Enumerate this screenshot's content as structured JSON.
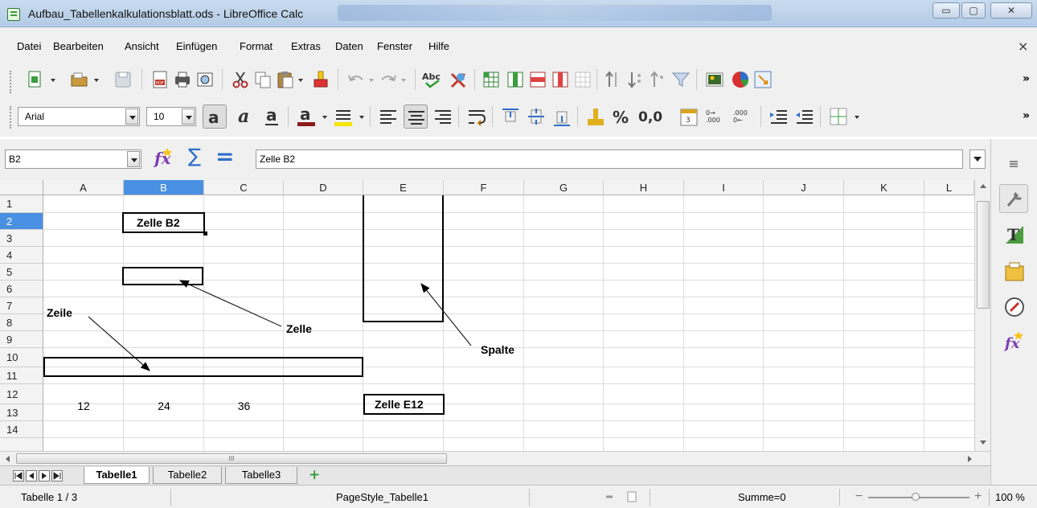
{
  "window": {
    "title": "Aufbau_Tabellenkalkulationsblatt.ods - LibreOffice Calc",
    "buttons": {
      "minimize": "▭",
      "maximize": "▢",
      "close": "✕"
    }
  },
  "menu": [
    "Datei",
    "Bearbeiten",
    "Ansicht",
    "Einfügen",
    "Format",
    "Extras",
    "Daten",
    "Fenster",
    "Hilfe"
  ],
  "menu_close": "×",
  "toolbar_standard": {
    "icons": [
      "new-document-icon",
      "open-icon",
      "save-icon",
      "export-pdf-icon",
      "print-icon",
      "print-preview-icon",
      "cut-icon",
      "copy-icon",
      "paste-icon",
      "clone-formatting-icon",
      "undo-icon",
      "redo-icon",
      "spellcheck-icon",
      "autospellcheck-icon",
      "row-insert-icon",
      "column-insert-icon",
      "row-delete-icon",
      "column-delete-icon",
      "merge-cells-icon",
      "sort-ascending-icon",
      "sort-descending-icon",
      "autofilter-icon",
      "filter-icon",
      "image-icon",
      "chart-icon",
      "pivot-table-icon"
    ],
    "spellcheck_label": "Abc",
    "more": "»"
  },
  "toolbar_formatting": {
    "font_name": "Arial",
    "font_size": "10",
    "percent": "%",
    "number_format": "0,0",
    "decimal_add": "0→ .000",
    "decimal_remove": ".000 0←",
    "more": "»"
  },
  "formula_bar": {
    "name_box": "B2",
    "content": "Zelle B2",
    "sum_symbol": "∑",
    "equals_symbol": "="
  },
  "sheet": {
    "columns": [
      "A",
      "B",
      "C",
      "D",
      "E",
      "F",
      "G",
      "H",
      "I",
      "J",
      "K",
      "L"
    ],
    "selected_column": "B",
    "rows": [
      "1",
      "2",
      "3",
      "4",
      "5",
      "6",
      "7",
      "8",
      "9",
      "10",
      "11",
      "12",
      "13",
      "14"
    ],
    "selected_row": "2",
    "cells": {
      "B2": "Zelle B2",
      "A12": "12",
      "B12": "24",
      "C12": "36",
      "E12": "Zelle E12"
    },
    "annotations": {
      "zeile": "Zeile",
      "zelle": "Zelle",
      "spalte": "Spalte"
    }
  },
  "hscroll_mark": "III",
  "tabs": [
    "Tabelle1",
    "Tabelle2",
    "Tabelle3"
  ],
  "active_tab": "Tabelle1",
  "add_tab": "+",
  "status": {
    "sheet_position": "Tabelle 1 / 3",
    "page_style": "PageStyle_Tabelle1",
    "sum": "Summe=0",
    "zoom": "100 %",
    "zoom_minus": "−",
    "zoom_plus": "+"
  }
}
